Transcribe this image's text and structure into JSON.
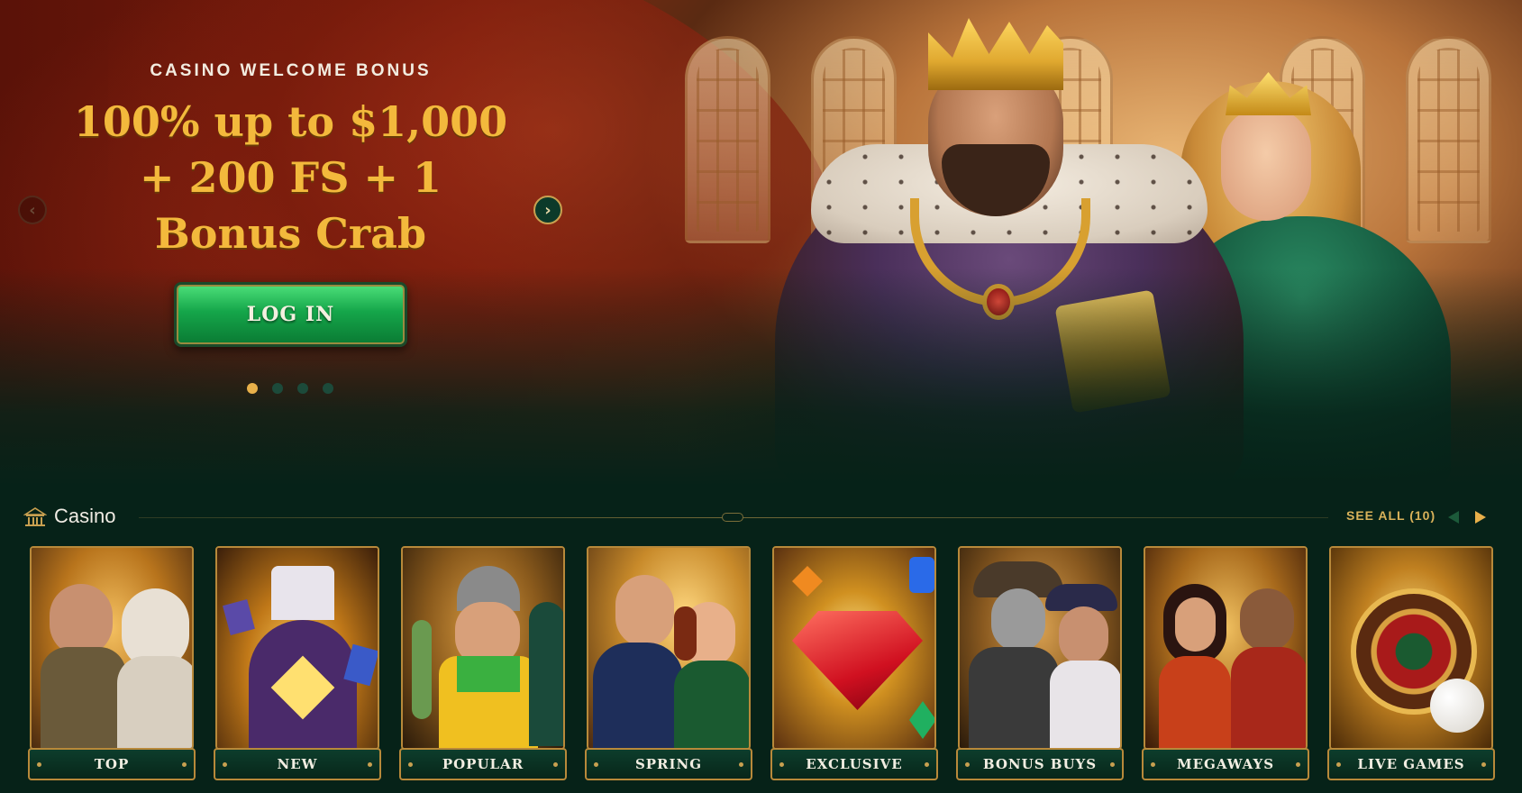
{
  "hero": {
    "kicker": "CASINO WELCOME BONUS",
    "title_line1": "100% up to $1,000",
    "title_line2": "+ 200 FS + 1",
    "title_line3": "Bonus Crab",
    "login_label": "LOG IN",
    "slides_total": 4,
    "active_slide": 1
  },
  "casino": {
    "title": "Casino",
    "see_all_label": "SEE ALL (10)",
    "icon": "casino-building-icon",
    "categories": [
      {
        "label": "TOP"
      },
      {
        "label": "NEW"
      },
      {
        "label": "POPULAR"
      },
      {
        "label": "SPRING"
      },
      {
        "label": "EXCLUSIVE"
      },
      {
        "label": "BONUS BUYS"
      },
      {
        "label": "MEGAWAYS"
      },
      {
        "label": "LIVE GAMES"
      }
    ]
  },
  "colors": {
    "background": "#062218",
    "accent_gold": "#f3b93c",
    "button_green": "#15a64a",
    "card_border": "#b8893a"
  }
}
